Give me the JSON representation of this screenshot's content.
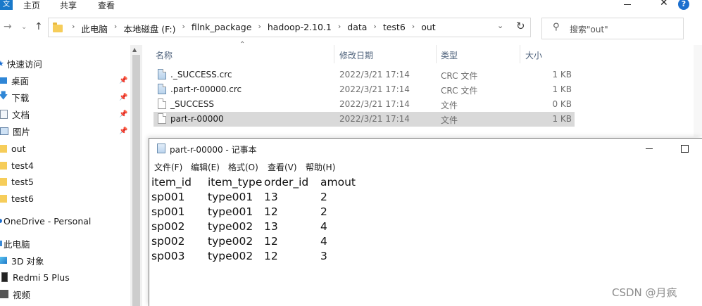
{
  "ribbon": {
    "file_tab": "文",
    "tabs": [
      "主页",
      "共享",
      "查看"
    ],
    "close_glyph": "✕",
    "help_glyph": "?"
  },
  "address": {
    "crumbs": [
      "此电脑",
      "本地磁盘 (F:)",
      "filnk_package",
      "hadoop-2.10.1",
      "data",
      "test6",
      "out"
    ],
    "separator": "›",
    "search_placeholder": "搜索\"out\""
  },
  "nav": {
    "quick_access": "快速访问",
    "items": [
      {
        "label": "桌面",
        "icon": "desktop-icon",
        "pinned": true
      },
      {
        "label": "下载",
        "icon": "download-icon",
        "pinned": true
      },
      {
        "label": "文档",
        "icon": "documents-icon",
        "pinned": true
      },
      {
        "label": "图片",
        "icon": "pictures-icon",
        "pinned": true
      },
      {
        "label": "out",
        "icon": "folder-icon",
        "pinned": false
      },
      {
        "label": "test4",
        "icon": "folder-icon",
        "pinned": false
      },
      {
        "label": "test5",
        "icon": "folder-icon",
        "pinned": false
      },
      {
        "label": "test6",
        "icon": "folder-icon",
        "pinned": false
      }
    ],
    "onedrive": "OneDrive - Personal",
    "this_pc": "此电脑",
    "pc_items": [
      {
        "label": "3D 对象",
        "icon": "3d-objects-icon"
      },
      {
        "label": "Redmi 5 Plus",
        "icon": "phone-icon"
      },
      {
        "label": "视频",
        "icon": "videos-icon"
      }
    ]
  },
  "columns": {
    "name": "名称",
    "date": "修改日期",
    "type": "类型",
    "size": "大小"
  },
  "files": [
    {
      "name": "._SUCCESS.crc",
      "date": "2022/3/21 17:14",
      "type": "CRC 文件",
      "size": "1 KB",
      "icon": "crc-file-icon",
      "selected": false
    },
    {
      "name": ".part-r-00000.crc",
      "date": "2022/3/21 17:14",
      "type": "CRC 文件",
      "size": "1 KB",
      "icon": "crc-file-icon",
      "selected": false
    },
    {
      "name": "_SUCCESS",
      "date": "2022/3/21 17:14",
      "type": "文件",
      "size": "0 KB",
      "icon": "file-icon",
      "selected": false
    },
    {
      "name": "part-r-00000",
      "date": "2022/3/21 17:14",
      "type": "文件",
      "size": "1 KB",
      "icon": "file-icon",
      "selected": true
    }
  ],
  "notepad": {
    "title": "part-r-00000 - 记事本",
    "menu": [
      "文件(F)",
      "编辑(E)",
      "格式(O)",
      "查看(V)",
      "帮助(H)"
    ],
    "rows": [
      [
        "item_id",
        "item_type",
        "order_id",
        "amout"
      ],
      [
        "sp001",
        "type001",
        "13",
        "2"
      ],
      [
        "sp001",
        "type001",
        "12",
        "2"
      ],
      [
        "sp002",
        "type002",
        "13",
        "4"
      ],
      [
        "sp002",
        "type002",
        "12",
        "4"
      ],
      [
        "sp003",
        "type002",
        "12",
        "3"
      ]
    ]
  },
  "watermark": "CSDN @月疯"
}
